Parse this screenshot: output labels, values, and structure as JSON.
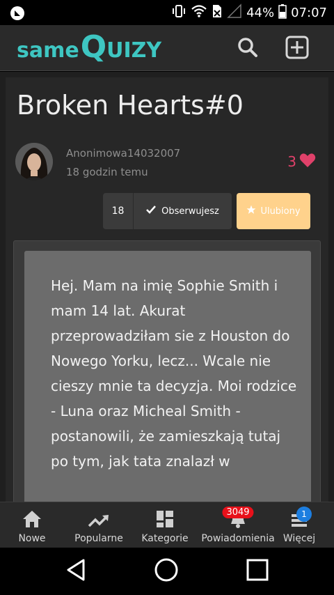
{
  "status_bar": {
    "battery_percent": "44%",
    "time": "07:07"
  },
  "app_bar": {
    "logo_same": "same",
    "logo_q": "Q",
    "logo_rest": "uizy",
    "search_icon": "search-icon",
    "add_icon": "plus-square-icon"
  },
  "post": {
    "title": "Broken Hearts#0",
    "author": "Anonimowa14032007",
    "time_ago": "18 godzin temu",
    "likes": "3",
    "followers_count": "18",
    "follow_label": "Obserwujesz",
    "favorite_label": "Ulubiony",
    "story_text": "Hej. Mam na imię Sophie Smith i mam 14 lat. Akurat przeprowadziłam sie z Houston do Nowego Yorku, lecz... Wcale nie cieszy mnie ta decyzja. Moi rodzice - Luna oraz Micheal Smith - postanowili, że zamieszkają tutaj po tym, jak tata znalazł w"
  },
  "bottom_nav": {
    "items": [
      {
        "label": "Nowe",
        "icon": "home-icon"
      },
      {
        "label": "Popularne",
        "icon": "trending-icon"
      },
      {
        "label": "Kategorie",
        "icon": "grid-icon"
      },
      {
        "label": "Powiadomienia",
        "icon": "bell-icon",
        "badge": "3049"
      },
      {
        "label": "Więcej",
        "icon": "menu-icon",
        "badge": "1"
      }
    ]
  },
  "colors": {
    "brand": "#3ec6c2",
    "heart": "#e0416a",
    "favorite": "#ffd28c",
    "badge_red": "#e8101a",
    "badge_blue": "#1d7ee0"
  }
}
